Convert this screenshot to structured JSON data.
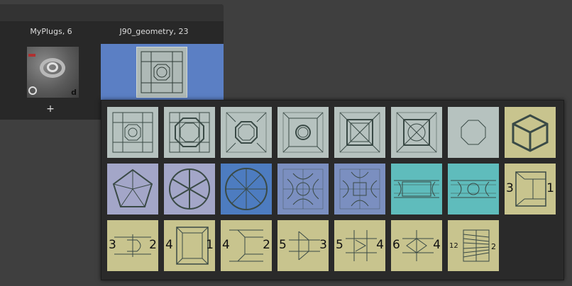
{
  "libraries": [
    {
      "label": "MyPlugs, 6",
      "thumb_letter": "d",
      "thumb_icon": "plug-render-icon"
    },
    {
      "label": "J90_geometry, 23",
      "selected": true,
      "thumb_icon": "grid-octagon-icon"
    }
  ],
  "add_button": "+",
  "colors": {
    "selected_tile": "#5b7fc4",
    "gray": "#b6c2bf",
    "lavender": "#a3a6c8",
    "blue": "#4d7cc0",
    "slate_blue": "#7b8fc0",
    "teal": "#5fbcbc",
    "olive": "#c8c48e"
  },
  "tiles": [
    {
      "icon": "grid-octagon-icon",
      "color": "gray"
    },
    {
      "icon": "octagon-grid-icon",
      "color": "gray"
    },
    {
      "icon": "octagon-bevel-icon",
      "color": "gray"
    },
    {
      "icon": "circle-in-square-icon",
      "color": "gray"
    },
    {
      "icon": "x-square-icon",
      "color": "gray"
    },
    {
      "icon": "x-square-circle-icon",
      "color": "gray"
    },
    {
      "icon": "octagon-icon",
      "color": "gray"
    },
    {
      "icon": "cube-icon",
      "color": "olive"
    },
    {
      "icon": "pentagon-spokes-icon",
      "color": "lavender"
    },
    {
      "icon": "hexagon-spokes-icon",
      "color": "lavender"
    },
    {
      "icon": "circle-spokes-icon",
      "color": "blue"
    },
    {
      "icon": "knot-pattern-icon",
      "color": "slate_blue"
    },
    {
      "icon": "knot-pattern-2-icon",
      "color": "slate_blue"
    },
    {
      "icon": "channel-icon",
      "color": "teal"
    },
    {
      "icon": "channel-2-icon",
      "color": "teal"
    },
    {
      "icon": "bridge-icon",
      "color": "olive",
      "left": "3",
      "right": "1"
    },
    {
      "icon": "arrow-bridge-icon",
      "color": "olive",
      "left": "3",
      "right": "2"
    },
    {
      "icon": "box-bridge-icon",
      "color": "olive",
      "left": "4",
      "right": "1"
    },
    {
      "icon": "box-bridge-2-icon",
      "color": "olive",
      "left": "4",
      "right": "2"
    },
    {
      "icon": "tee-bridge-icon",
      "color": "olive",
      "left": "5",
      "right": "3"
    },
    {
      "icon": "cross-bridge-icon",
      "color": "olive",
      "left": "5",
      "right": "4"
    },
    {
      "icon": "diamond-bridge-icon",
      "color": "olive",
      "left": "6",
      "right": "4"
    },
    {
      "icon": "fan-bridge-icon",
      "color": "olive",
      "left": "12",
      "right": "2"
    }
  ]
}
